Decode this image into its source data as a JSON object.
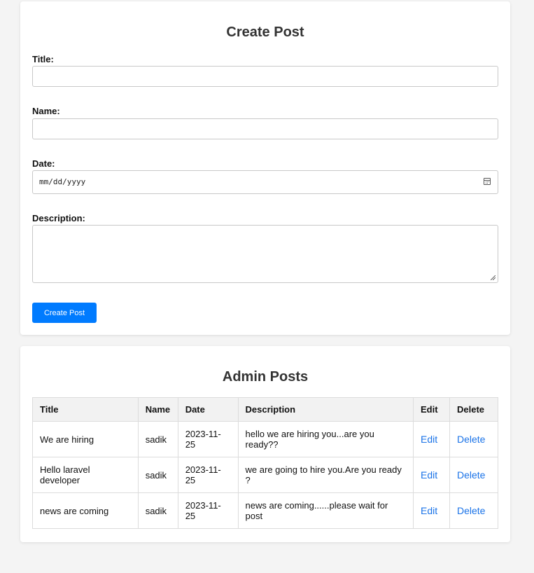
{
  "create_form": {
    "heading": "Create Post",
    "title_label": "Title:",
    "title_value": "",
    "name_label": "Name:",
    "name_value": "",
    "date_label": "Date:",
    "date_placeholder": "mm/dd/yyyy",
    "date_icon": "calendar-icon",
    "description_label": "Description:",
    "description_value": "",
    "submit_label": "Create Post"
  },
  "admin_posts": {
    "heading": "Admin Posts",
    "columns": [
      "Title",
      "Name",
      "Date",
      "Description",
      "Edit",
      "Delete"
    ],
    "rows": [
      {
        "title": "We are hiring",
        "name": "sadik",
        "date": "2023-11-25",
        "description": "hello we are hiring you...are you ready??",
        "edit": "Edit",
        "delete": "Delete"
      },
      {
        "title": "Hello laravel developer",
        "name": "sadik",
        "date": "2023-11-25",
        "description": "we are going to hire you.Are you ready ?",
        "edit": "Edit",
        "delete": "Delete"
      },
      {
        "title": "news are coming",
        "name": "sadik",
        "date": "2023-11-25",
        "description": "news are coming......please wait for post",
        "edit": "Edit",
        "delete": "Delete"
      }
    ]
  },
  "colors": {
    "primary_button": "#007bff",
    "link": "#1a73e8",
    "page_background": "#f4f4f4",
    "header_background": "#f2f2f2"
  }
}
